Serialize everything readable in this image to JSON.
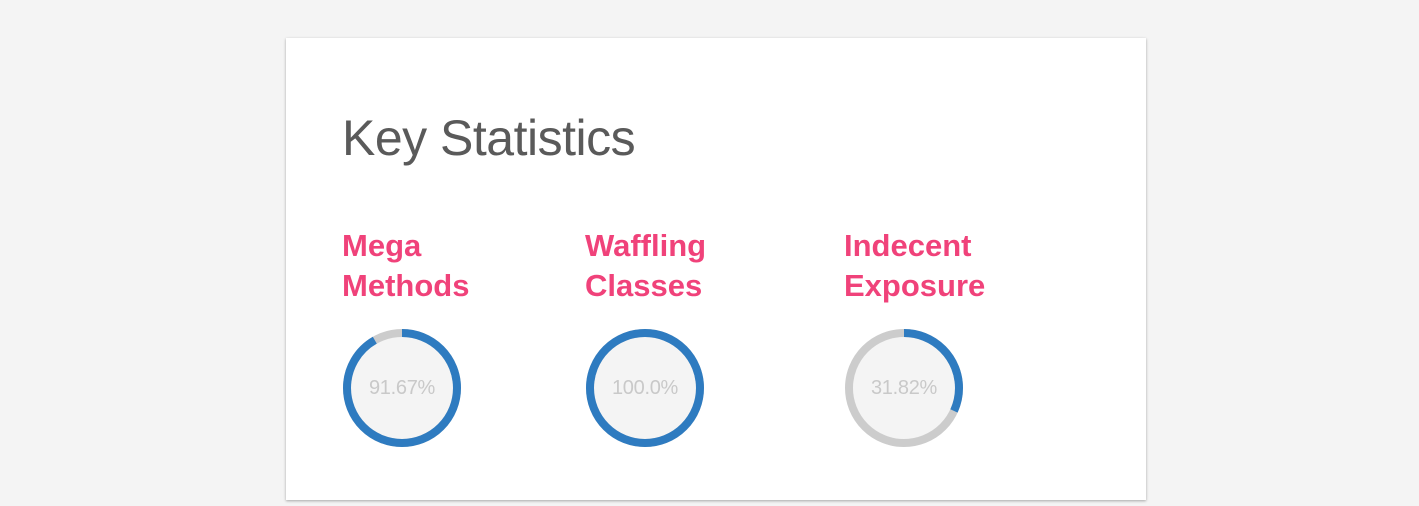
{
  "card": {
    "title": "Key Statistics"
  },
  "colors": {
    "accent": "#f0427a",
    "ring_fill": "#2e7bc0",
    "ring_track": "#cccccc",
    "ring_inner": "#f4f4f4",
    "title_text": "#5a5a5a"
  },
  "stats": [
    {
      "label": "Mega\nMethods",
      "value_text": "91.67%",
      "percent": 91.67
    },
    {
      "label": "Waffling\nClasses",
      "value_text": "100.0%",
      "percent": 100.0
    },
    {
      "label": "Indecent\nExposure",
      "value_text": "31.82%",
      "percent": 31.82
    }
  ]
}
